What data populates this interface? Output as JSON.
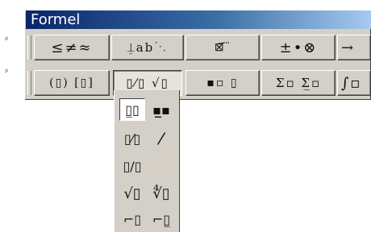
{
  "window": {
    "title": "Formel"
  },
  "toolbar_row1": [
    {
      "name": "relational-symbols-button",
      "label": "≤≠≈"
    },
    {
      "name": "spaces-ellipses-button",
      "label": "⍊ab⋱"
    },
    {
      "name": "embellishments-button",
      "label": "⊠⃗ ⃛"
    },
    {
      "name": "operator-symbols-button",
      "label": "±•⊗"
    },
    {
      "name": "arrow-symbols-button",
      "label": "→"
    }
  ],
  "toolbar_row2": [
    {
      "name": "fence-templates-button",
      "label": "(▯) [▯]"
    },
    {
      "name": "fraction-radical-templates-button",
      "label": "▯⁄▯ √▯"
    },
    {
      "name": "subscript-superscript-templates-button",
      "label": "▪▫ ▯̣"
    },
    {
      "name": "summation-templates-button",
      "label": "Σ▫ Σ̲▫"
    },
    {
      "name": "integral-templates-button",
      "label": "∫▫"
    }
  ],
  "dropdown": {
    "items": [
      {
        "name": "full-fraction",
        "label": "▯̲▯"
      },
      {
        "name": "small-fraction",
        "label": "▪̲▪"
      },
      {
        "name": "slash-fraction",
        "label": "▯⁄▯"
      },
      {
        "name": "small-slash-fraction",
        "label": "⁄"
      },
      {
        "name": "linear-fraction",
        "label": "▯/▯"
      },
      {
        "name": "square-root",
        "label": "√▯"
      },
      {
        "name": "nth-root",
        "label": "∜▯"
      },
      {
        "name": "long-division",
        "label": "⌐▯"
      },
      {
        "name": "long-division-quotient",
        "label": "⌐▯̲"
      }
    ]
  }
}
